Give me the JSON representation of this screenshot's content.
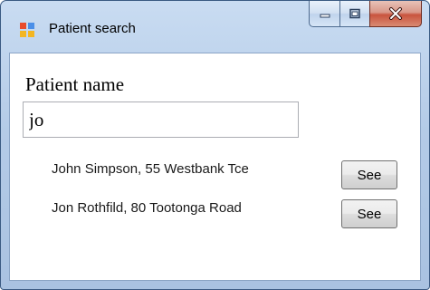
{
  "window": {
    "title": "Patient search",
    "icons": {
      "app": "windows-form-icon",
      "minimize": "minimize-icon",
      "maximize": "maximize-icon",
      "close": "close-icon"
    }
  },
  "form": {
    "patient_name_label": "Patient name",
    "patient_name_value": "jo"
  },
  "results": [
    {
      "text": "John Simpson, 55 Westbank Tce",
      "button_label": "See"
    },
    {
      "text": "Jon Rothfild, 80 Tootonga Road",
      "button_label": "See"
    }
  ],
  "colors": {
    "title_bar": "#b4cbe7",
    "close_button": "#c9543e",
    "window_border": "#3a5a82"
  }
}
